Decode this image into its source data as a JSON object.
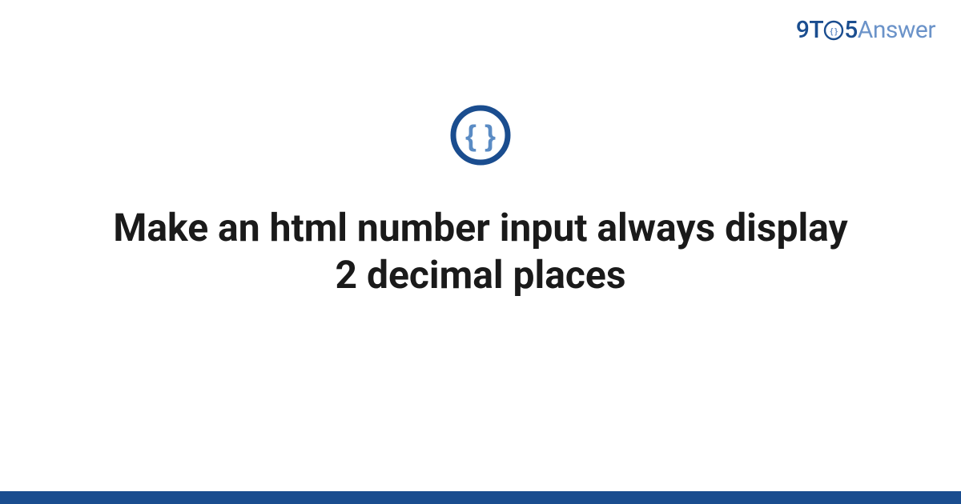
{
  "brand": {
    "part1": "9",
    "part2": "T",
    "part3_inner": "{ }",
    "part4": "5",
    "part5": "Answer"
  },
  "icon": {
    "name": "code-braces-icon",
    "glyph": "{ }"
  },
  "title": "Make an html number input always display 2 decimal places",
  "colors": {
    "brand_dark": "#1a4d8f",
    "brand_light": "#6b93c9",
    "text": "#1a1a1a"
  }
}
